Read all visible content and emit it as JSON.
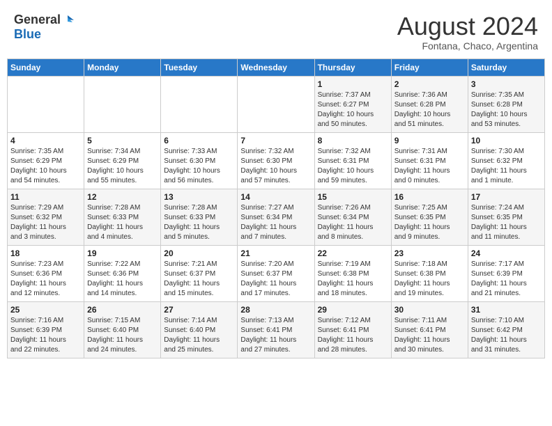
{
  "header": {
    "logo_general": "General",
    "logo_blue": "Blue",
    "title": "August 2024",
    "subtitle": "Fontana, Chaco, Argentina"
  },
  "weekdays": [
    "Sunday",
    "Monday",
    "Tuesday",
    "Wednesday",
    "Thursday",
    "Friday",
    "Saturday"
  ],
  "weeks": [
    [
      {
        "day": "",
        "info": ""
      },
      {
        "day": "",
        "info": ""
      },
      {
        "day": "",
        "info": ""
      },
      {
        "day": "",
        "info": ""
      },
      {
        "day": "1",
        "info": "Sunrise: 7:37 AM\nSunset: 6:27 PM\nDaylight: 10 hours\nand 50 minutes."
      },
      {
        "day": "2",
        "info": "Sunrise: 7:36 AM\nSunset: 6:28 PM\nDaylight: 10 hours\nand 51 minutes."
      },
      {
        "day": "3",
        "info": "Sunrise: 7:35 AM\nSunset: 6:28 PM\nDaylight: 10 hours\nand 53 minutes."
      }
    ],
    [
      {
        "day": "4",
        "info": "Sunrise: 7:35 AM\nSunset: 6:29 PM\nDaylight: 10 hours\nand 54 minutes."
      },
      {
        "day": "5",
        "info": "Sunrise: 7:34 AM\nSunset: 6:29 PM\nDaylight: 10 hours\nand 55 minutes."
      },
      {
        "day": "6",
        "info": "Sunrise: 7:33 AM\nSunset: 6:30 PM\nDaylight: 10 hours\nand 56 minutes."
      },
      {
        "day": "7",
        "info": "Sunrise: 7:32 AM\nSunset: 6:30 PM\nDaylight: 10 hours\nand 57 minutes."
      },
      {
        "day": "8",
        "info": "Sunrise: 7:32 AM\nSunset: 6:31 PM\nDaylight: 10 hours\nand 59 minutes."
      },
      {
        "day": "9",
        "info": "Sunrise: 7:31 AM\nSunset: 6:31 PM\nDaylight: 11 hours\nand 0 minutes."
      },
      {
        "day": "10",
        "info": "Sunrise: 7:30 AM\nSunset: 6:32 PM\nDaylight: 11 hours\nand 1 minute."
      }
    ],
    [
      {
        "day": "11",
        "info": "Sunrise: 7:29 AM\nSunset: 6:32 PM\nDaylight: 11 hours\nand 3 minutes."
      },
      {
        "day": "12",
        "info": "Sunrise: 7:28 AM\nSunset: 6:33 PM\nDaylight: 11 hours\nand 4 minutes."
      },
      {
        "day": "13",
        "info": "Sunrise: 7:28 AM\nSunset: 6:33 PM\nDaylight: 11 hours\nand 5 minutes."
      },
      {
        "day": "14",
        "info": "Sunrise: 7:27 AM\nSunset: 6:34 PM\nDaylight: 11 hours\nand 7 minutes."
      },
      {
        "day": "15",
        "info": "Sunrise: 7:26 AM\nSunset: 6:34 PM\nDaylight: 11 hours\nand 8 minutes."
      },
      {
        "day": "16",
        "info": "Sunrise: 7:25 AM\nSunset: 6:35 PM\nDaylight: 11 hours\nand 9 minutes."
      },
      {
        "day": "17",
        "info": "Sunrise: 7:24 AM\nSunset: 6:35 PM\nDaylight: 11 hours\nand 11 minutes."
      }
    ],
    [
      {
        "day": "18",
        "info": "Sunrise: 7:23 AM\nSunset: 6:36 PM\nDaylight: 11 hours\nand 12 minutes."
      },
      {
        "day": "19",
        "info": "Sunrise: 7:22 AM\nSunset: 6:36 PM\nDaylight: 11 hours\nand 14 minutes."
      },
      {
        "day": "20",
        "info": "Sunrise: 7:21 AM\nSunset: 6:37 PM\nDaylight: 11 hours\nand 15 minutes."
      },
      {
        "day": "21",
        "info": "Sunrise: 7:20 AM\nSunset: 6:37 PM\nDaylight: 11 hours\nand 17 minutes."
      },
      {
        "day": "22",
        "info": "Sunrise: 7:19 AM\nSunset: 6:38 PM\nDaylight: 11 hours\nand 18 minutes."
      },
      {
        "day": "23",
        "info": "Sunrise: 7:18 AM\nSunset: 6:38 PM\nDaylight: 11 hours\nand 19 minutes."
      },
      {
        "day": "24",
        "info": "Sunrise: 7:17 AM\nSunset: 6:39 PM\nDaylight: 11 hours\nand 21 minutes."
      }
    ],
    [
      {
        "day": "25",
        "info": "Sunrise: 7:16 AM\nSunset: 6:39 PM\nDaylight: 11 hours\nand 22 minutes."
      },
      {
        "day": "26",
        "info": "Sunrise: 7:15 AM\nSunset: 6:40 PM\nDaylight: 11 hours\nand 24 minutes."
      },
      {
        "day": "27",
        "info": "Sunrise: 7:14 AM\nSunset: 6:40 PM\nDaylight: 11 hours\nand 25 minutes."
      },
      {
        "day": "28",
        "info": "Sunrise: 7:13 AM\nSunset: 6:41 PM\nDaylight: 11 hours\nand 27 minutes."
      },
      {
        "day": "29",
        "info": "Sunrise: 7:12 AM\nSunset: 6:41 PM\nDaylight: 11 hours\nand 28 minutes."
      },
      {
        "day": "30",
        "info": "Sunrise: 7:11 AM\nSunset: 6:41 PM\nDaylight: 11 hours\nand 30 minutes."
      },
      {
        "day": "31",
        "info": "Sunrise: 7:10 AM\nSunset: 6:42 PM\nDaylight: 11 hours\nand 31 minutes."
      }
    ]
  ]
}
